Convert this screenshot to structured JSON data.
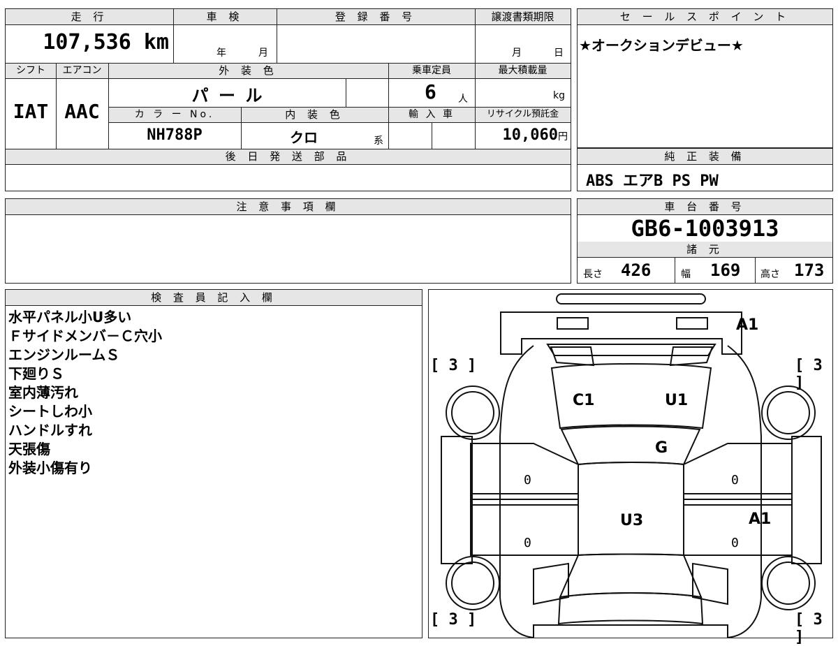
{
  "top": {
    "hdr_mileage": "走 行",
    "hdr_inspection": "車 検",
    "hdr_reg_no": "登 録 番 号",
    "hdr_transfer": "譲渡書類期限",
    "mileage": "107,536",
    "mileage_unit": "km",
    "year_char": "年",
    "month_char": "月",
    "transfer_month": "月",
    "transfer_day": "日"
  },
  "specs": {
    "hdr_shift": "シフト",
    "hdr_ac": "エアコン",
    "hdr_exterior": "外 装 色",
    "hdr_capacity": "乗車定員",
    "hdr_max_load": "最大積載量",
    "shift": "IAT",
    "ac": "AAC",
    "exterior_color": "パ ー ル",
    "capacity": "6",
    "capacity_unit": "人",
    "load_unit": "kg",
    "hdr_color_no": "カ ラ ー No.",
    "hdr_interior": "内 装 色",
    "hdr_import": "輸 入 車",
    "hdr_recycle": "リサイクル預託金",
    "color_no": "NH788P",
    "interior_color": "クロ",
    "interior_suffix": "系",
    "recycle_fee": "10,060",
    "recycle_unit": "円",
    "hdr_later_parts": "後 日 発 送 部 品"
  },
  "sales": {
    "hdr": "セ ー ル ス ポ イ ン ト",
    "text": "★オークションデビュー★"
  },
  "equipment": {
    "hdr": "純 正 装 備",
    "text": "ABS エアB PS PW"
  },
  "notes": {
    "hdr": "注 意 事 項 欄"
  },
  "chassis": {
    "hdr": "車 台 番 号",
    "number": "GB6-1003913",
    "hdr_dims": "諸 元",
    "length_label": "長さ",
    "length": "426",
    "width_label": "幅",
    "width": "169",
    "height_label": "高さ",
    "height": "173"
  },
  "inspector": {
    "hdr": "検 査 員 記 入 欄",
    "lines": [
      "水平パネル小U多い",
      "Ｆサイドメンバ－Ｃ穴小",
      "エンジンルームＳ",
      "下廻りＳ",
      "室内薄汚れ",
      "シートしわ小",
      "ハンドルすれ",
      "天張傷",
      "外装小傷有り"
    ]
  },
  "diagram": {
    "bracket_tl": "[ 3 ]",
    "bracket_tr": "[ 3 ]",
    "bracket_bl": "[ 3 ]",
    "bracket_br": "[ 3 ]",
    "front_bumper": "A1",
    "hood_left": "C1",
    "hood_right": "U1",
    "windshield": "G",
    "roof": "U3",
    "right_rear_door": "A1",
    "zero_lf": "0",
    "zero_lr": "0",
    "zero_rf": "0",
    "zero_rr": "0"
  }
}
